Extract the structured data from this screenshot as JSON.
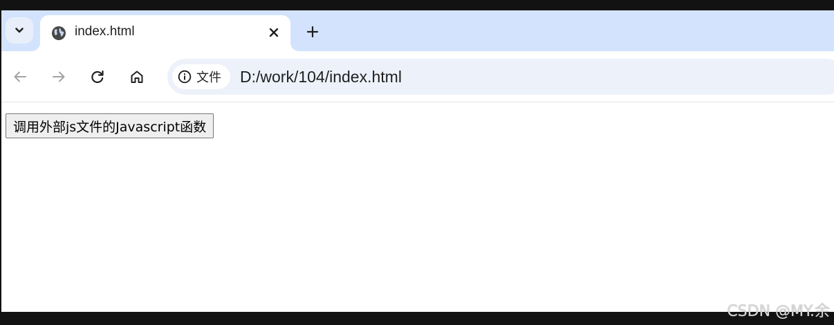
{
  "browser": {
    "tab": {
      "title": "index.html",
      "favicon": "globe-icon"
    },
    "tab_search_icon": "chevron-down-icon",
    "close_icon": "close-icon",
    "new_tab_icon": "plus-icon",
    "toolbar": {
      "back_icon": "arrow-left-icon",
      "forward_icon": "arrow-right-icon",
      "reload_icon": "reload-icon",
      "home_icon": "home-icon"
    },
    "address_bar": {
      "site_chip_icon": "info-icon",
      "site_chip_label": "文件",
      "url": "D:/work/104/index.html"
    }
  },
  "page": {
    "button_label": "调用外部js文件的Javascript函数"
  },
  "watermark": {
    "text": "CSDN @MY.余"
  },
  "colors": {
    "tabstrip_bg": "#d3e3fd",
    "omnibox_bg": "#edf2fa",
    "frame_bg": "#121212"
  }
}
